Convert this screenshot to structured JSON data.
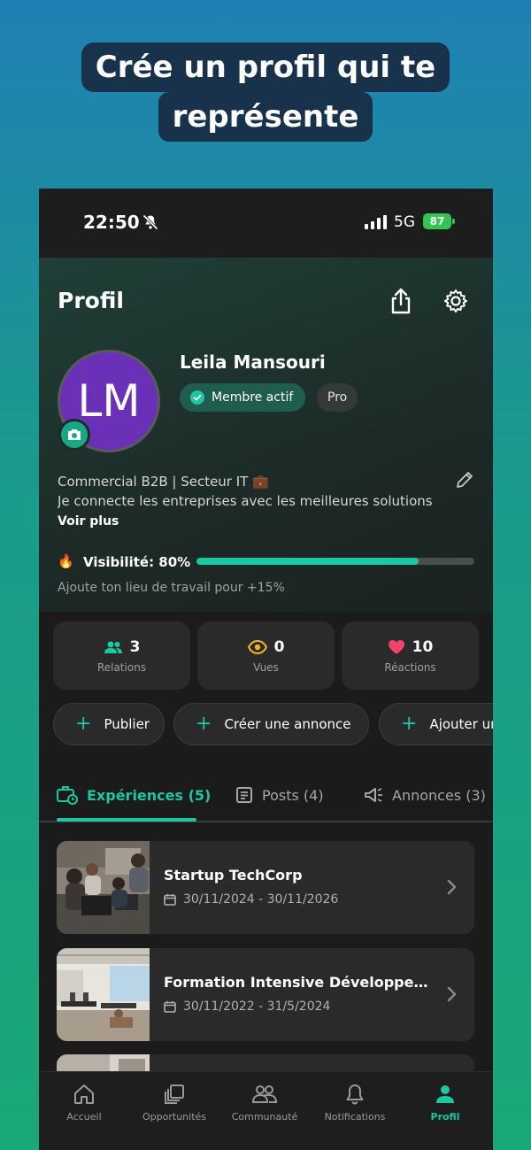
{
  "headline": {
    "line1": "Crée un profil qui te",
    "line2": "représente"
  },
  "status_bar": {
    "time": "22:50",
    "network": "5G",
    "battery": "87"
  },
  "profile": {
    "title": "Profil",
    "initials": "LM",
    "name": "Leila Mansouri",
    "badge_active": "Membre actif",
    "badge_pro": "Pro",
    "bio_line1": "Commercial B2B | Secteur IT 💼",
    "bio_line2": "Je connecte les entreprises avec les meilleures solutions",
    "see_more": "Voir plus",
    "visibility_label": "Visibilité: 80%",
    "visibility_fraction": 0.8,
    "visibility_hint": "Ajoute ton lieu de travail pour +15%"
  },
  "stats": [
    {
      "value": "3",
      "label": "Relations",
      "icon": "people-icon",
      "color": "#1cc7a1"
    },
    {
      "value": "0",
      "label": "Vues",
      "icon": "eye-icon",
      "color": "#f0b429"
    },
    {
      "value": "10",
      "label": "Réactions",
      "icon": "heart-icon",
      "color": "#f2416b"
    }
  ],
  "actions": [
    "Publier",
    "Créer une annonce",
    "Ajouter une"
  ],
  "tabs": [
    "Expériences (5)",
    "Posts (4)",
    "Annonces (3)"
  ],
  "experiences": [
    {
      "title": "Startup TechCorp",
      "dates": "30/11/2024 - 30/11/2026"
    },
    {
      "title": "Formation Intensive Développement",
      "dates": "30/11/2022 - 31/5/2024"
    }
  ],
  "nav": [
    "Accueil",
    "Opportunités",
    "Communauté",
    "Notifications",
    "Profil"
  ],
  "colors": {
    "accent": "#1cc7a1",
    "avatar": "#6a30b8"
  }
}
